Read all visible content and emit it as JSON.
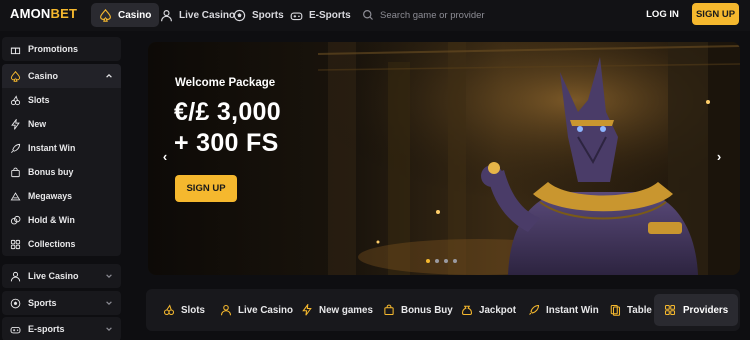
{
  "header": {
    "logo_prefix": "AMON",
    "logo_suffix": "BET",
    "nav": [
      {
        "label": "Casino",
        "icon": "spade-icon",
        "active": true
      },
      {
        "label": "Live Casino",
        "icon": "dealer-icon",
        "active": false
      },
      {
        "label": "Sports",
        "icon": "soccer-ball-icon",
        "active": false
      },
      {
        "label": "E-Sports",
        "icon": "gamepad-icon",
        "active": false
      }
    ],
    "search_placeholder": "Search game or provider",
    "login_label": "LOG IN",
    "signup_label": "SIGN UP"
  },
  "sidebar": {
    "promotions": "Promotions",
    "casino": "Casino",
    "casino_items": [
      "Slots",
      "New",
      "Instant Win",
      "Bonus buy",
      "Megaways",
      "Hold & Win",
      "Collections"
    ],
    "live_casino": "Live Casino",
    "sports": "Sports",
    "esports": "E-sports"
  },
  "banner": {
    "welcome": "Welcome Package",
    "amount_line1": "€/£ 3,000",
    "amount_line2": "+ 300 FS",
    "cta": "SIGN UP",
    "prev": "‹",
    "next": "›",
    "slides_total": 4,
    "slide_active": 1
  },
  "categories": {
    "items": [
      "Slots",
      "Live Casino",
      "New games",
      "Bonus Buy",
      "Jackpot",
      "Instant Win",
      "Table"
    ],
    "providers": "Providers"
  },
  "colors": {
    "accent": "#f5b82e",
    "bg": "#0e0e11",
    "panel": "#18181c"
  }
}
